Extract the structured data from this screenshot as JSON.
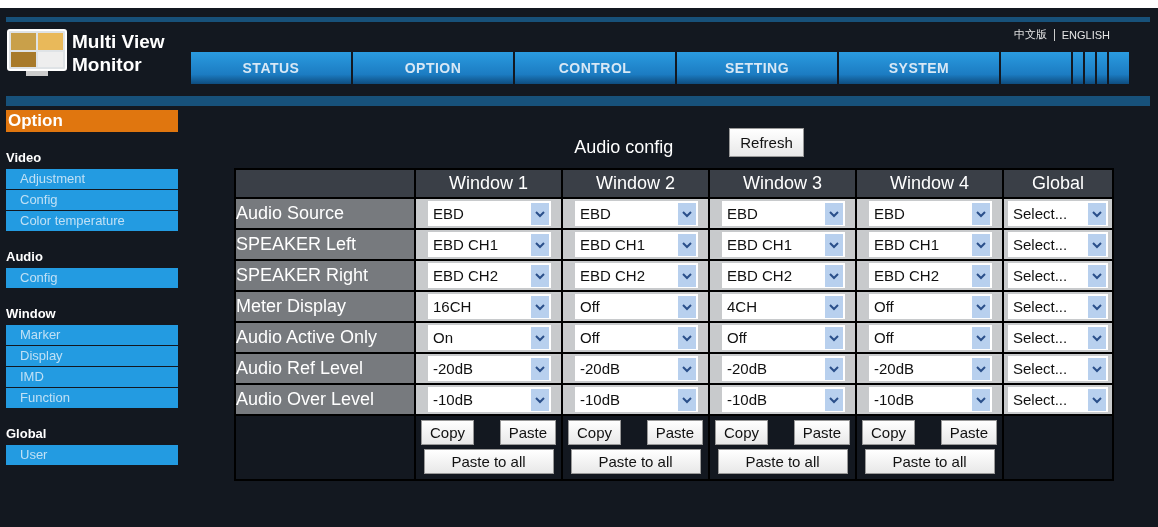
{
  "logo": {
    "title_lines": [
      "Multi View",
      "Monitor"
    ]
  },
  "languages": [
    "中文版",
    "ENGLISH"
  ],
  "tabs": [
    {
      "label": "STATUS"
    },
    {
      "label": "OPTION"
    },
    {
      "label": "CONTROL"
    },
    {
      "label": "SETTING"
    },
    {
      "label": "SYSTEM"
    }
  ],
  "sidebar": {
    "title": "Option",
    "sections": [
      {
        "title": "Video",
        "items": [
          {
            "label": "Adjustment"
          },
          {
            "label": "Config"
          },
          {
            "label": "Color temperature"
          }
        ]
      },
      {
        "title": "Audio",
        "items": [
          {
            "label": "Config"
          }
        ]
      },
      {
        "title": "Window",
        "items": [
          {
            "label": "Marker"
          },
          {
            "label": "Display"
          },
          {
            "label": "IMD"
          },
          {
            "label": "Function"
          }
        ]
      },
      {
        "title": "Global",
        "items": [
          {
            "label": "User"
          }
        ]
      }
    ]
  },
  "page": {
    "title": "Audio config",
    "refresh_button": "Refresh"
  },
  "table": {
    "columns": [
      "Window 1",
      "Window 2",
      "Window 3",
      "Window 4",
      "Global"
    ],
    "rows": [
      {
        "label": "Audio Source",
        "values": [
          "EBD",
          "EBD",
          "EBD",
          "EBD",
          "Select..."
        ]
      },
      {
        "label": "SPEAKER Left",
        "values": [
          "EBD CH1",
          "EBD CH1",
          "EBD CH1",
          "EBD CH1",
          "Select..."
        ]
      },
      {
        "label": "SPEAKER Right",
        "values": [
          "EBD CH2",
          "EBD CH2",
          "EBD CH2",
          "EBD CH2",
          "Select..."
        ]
      },
      {
        "label": "Meter Display",
        "values": [
          "16CH",
          "Off",
          "4CH",
          "Off",
          "Select..."
        ]
      },
      {
        "label": "Audio Active Only",
        "values": [
          "On",
          "Off",
          "Off",
          "Off",
          "Select..."
        ]
      },
      {
        "label": "Audio Ref Level",
        "values": [
          "-20dB",
          "-20dB",
          "-20dB",
          "-20dB",
          "Select..."
        ]
      },
      {
        "label": "Audio Over Level",
        "values": [
          "-10dB",
          "-10dB",
          "-10dB",
          "-10dB",
          "Select..."
        ]
      }
    ],
    "window_actions": [
      {
        "copy": "Copy",
        "paste": "Paste",
        "paste_all": "Paste to all"
      },
      {
        "copy": "Copy",
        "paste": "Paste",
        "paste_all": "Paste to all"
      },
      {
        "copy": "Copy",
        "paste": "Paste",
        "paste_all": "Paste to all"
      },
      {
        "copy": "Copy",
        "paste": "Paste",
        "paste_all": "Paste to all"
      }
    ]
  }
}
